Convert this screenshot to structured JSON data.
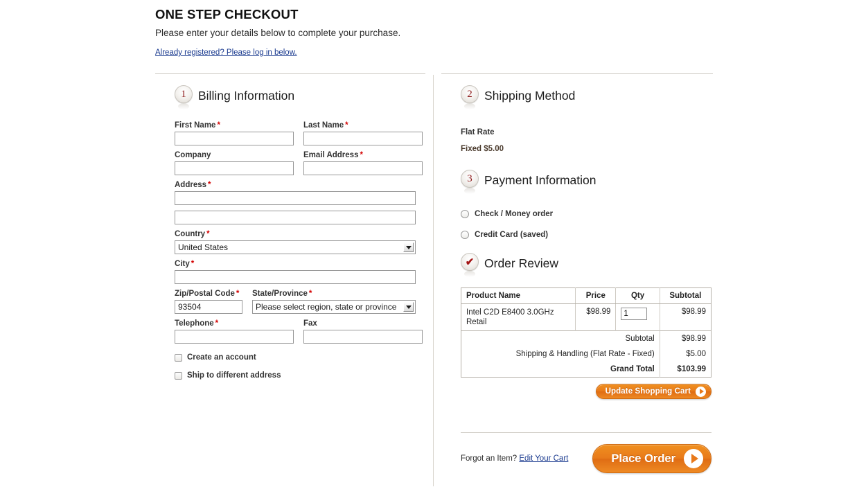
{
  "header": {
    "title": "ONE STEP CHECKOUT",
    "subtitle": "Please enter your details below to complete your purchase.",
    "login_link": "Already registered? Please log in below."
  },
  "billing": {
    "step_number": "1",
    "title": "Billing Information",
    "fields": {
      "first_name": {
        "label": "First Name",
        "required": "*",
        "value": ""
      },
      "last_name": {
        "label": "Last Name",
        "required": "*",
        "value": ""
      },
      "company": {
        "label": "Company",
        "required": "",
        "value": ""
      },
      "email": {
        "label": "Email Address",
        "required": "*",
        "value": ""
      },
      "address": {
        "label": "Address",
        "required": "*",
        "value": ""
      },
      "address2": {
        "label": "",
        "required": "",
        "value": ""
      },
      "country": {
        "label": "Country",
        "required": "*",
        "value": "United States"
      },
      "city": {
        "label": "City",
        "required": "*",
        "value": ""
      },
      "zip": {
        "label": "Zip/Postal Code",
        "required": "*",
        "value": "93504"
      },
      "state": {
        "label": "State/Province",
        "required": "*",
        "value": "Please select region, state or province"
      },
      "telephone": {
        "label": "Telephone",
        "required": "*",
        "value": ""
      },
      "fax": {
        "label": "Fax",
        "required": "",
        "value": ""
      }
    },
    "checkboxes": {
      "create_account": "Create an account",
      "ship_different": "Ship to different address"
    }
  },
  "shipping": {
    "step_number": "2",
    "title": "Shipping Method",
    "method_name": "Flat Rate",
    "method_price": "Fixed $5.00"
  },
  "payment": {
    "step_number": "3",
    "title": "Payment Information",
    "options": [
      {
        "label": "Check / Money order"
      },
      {
        "label": "Credit Card (saved)"
      }
    ]
  },
  "order_review": {
    "badge": "✔",
    "title": "Order Review",
    "columns": [
      "Product Name",
      "Price",
      "Qty",
      "Subtotal"
    ],
    "items": [
      {
        "name": "Intel C2D E8400 3.0GHz Retail",
        "price": "$98.99",
        "qty": "1",
        "subtotal": "$98.99"
      }
    ],
    "totals": [
      {
        "label": "Subtotal",
        "value": "$98.99"
      },
      {
        "label": "Shipping & Handling (Flat Rate - Fixed)",
        "value": "$5.00"
      }
    ],
    "grand_total": {
      "label": "Grand Total",
      "value": "$103.99"
    },
    "update_button": "Update Shopping Cart"
  },
  "footer": {
    "forgot_text": "Forgot an Item?",
    "edit_cart_link": "Edit Your Cart",
    "place_order_button": "Place Order"
  },
  "colors": {
    "accent_orange": "#e8791a",
    "link_blue": "#1a3a8f",
    "required_red": "#d40000",
    "badge_red": "#8d1b1b"
  }
}
